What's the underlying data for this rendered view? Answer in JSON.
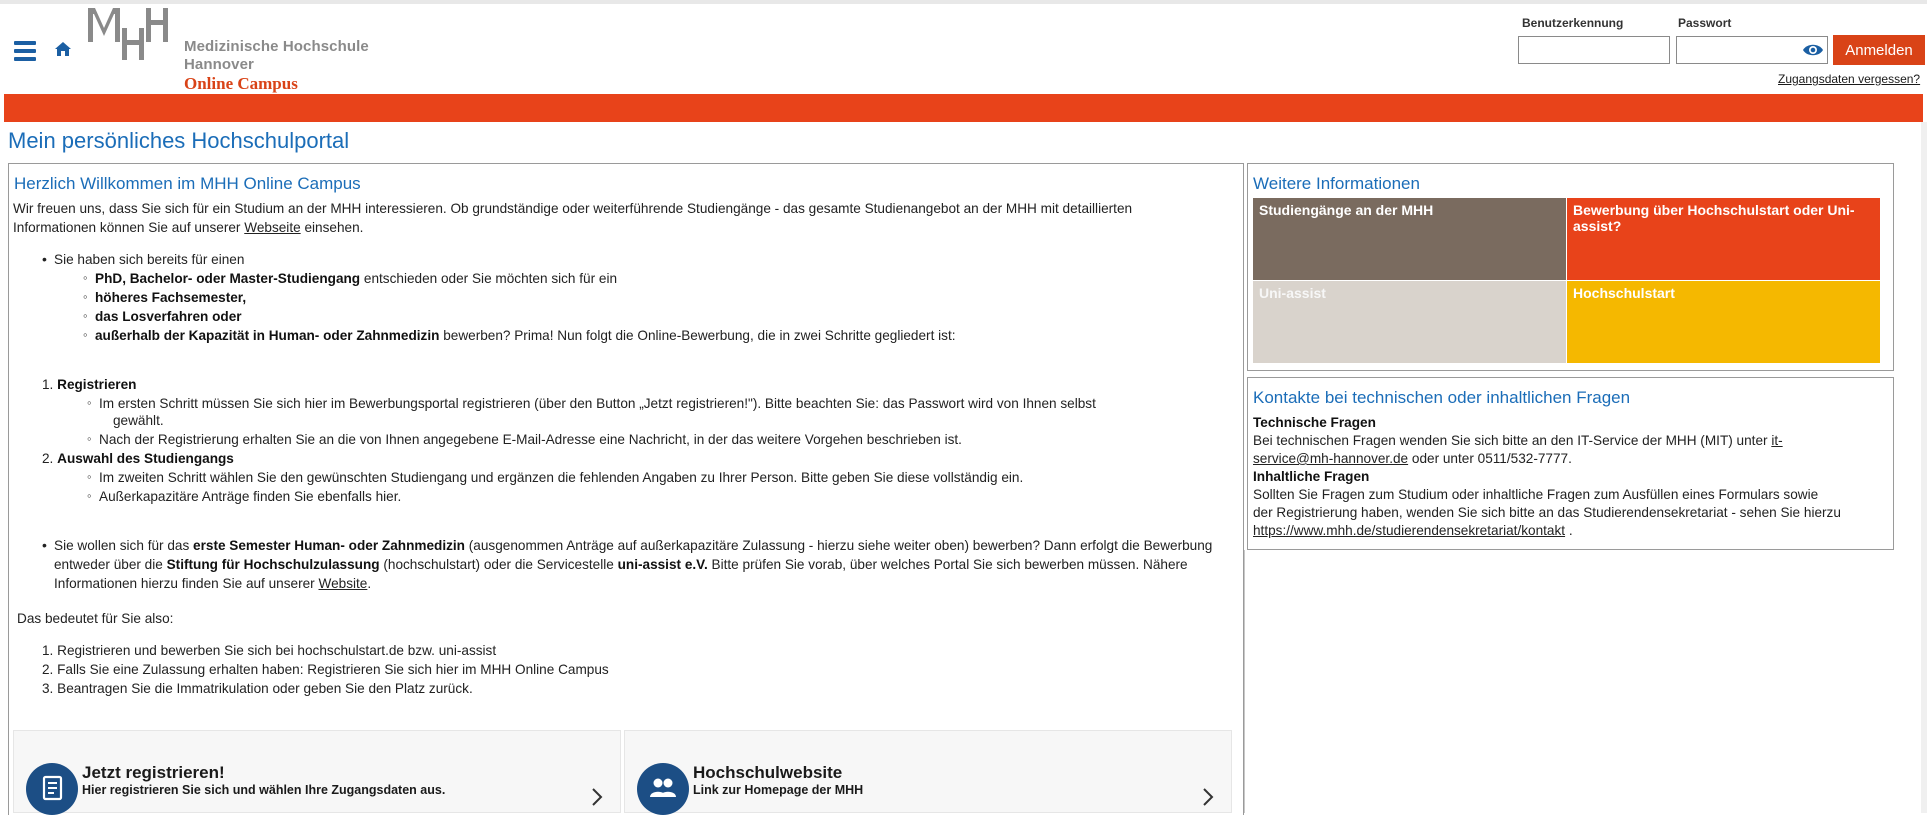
{
  "header": {
    "logo_mark": "MHH",
    "logo_line1": "Medizinische Hochschule",
    "logo_line2": "Hannover",
    "logo_campus": "Online Campus",
    "username_label": "Benutzerkennung",
    "password_label": "Passwort",
    "username_value": "",
    "password_value": "",
    "login_button": "Anmelden",
    "forgot_link": "Zugangsdaten vergessen?"
  },
  "colors": {
    "accent_orange": "#e8431a",
    "title_blue": "#1b6db8",
    "nav_blue": "#1b5fa3",
    "card_icon": "#1c4e85",
    "tile_brown": "#7a6b5f",
    "tile_red": "#e8431a",
    "tile_beige": "#d9d3cc",
    "tile_yellow": "#f5b800"
  },
  "page_title": "Mein persönliches Hochschulportal",
  "welcome": {
    "title": "Herzlich Willkommen im MHH Online Campus",
    "intro_1": "Wir freuen uns, dass Sie sich für ein Studium an der MHH interessieren. Ob grundständige oder weiterführende Studiengänge - das gesamte Studienangebot an der MHH mit detaillierten",
    "intro_2": "Informationen können Sie auf unserer",
    "intro_link": "Webseite",
    "intro_3": "einsehen.",
    "bullet_1": "Sie haben sich bereits für einen",
    "sub_1_bold": "PhD, Bachelor- oder Master-Studiengang",
    "sub_1_rest": "entschieden oder Sie möchten sich für ein",
    "sub_2_bold": "höheres Fachsemester,",
    "sub_3_bold": "das Losverfahren oder",
    "sub_4_bold": "außerhalb der Kapazität in Human- oder Zahnmedizin",
    "sub_4_rest": "bewerben? Prima! Nun folgt die Online-Bewerbung, die in zwei Schritte gegliedert ist:",
    "step_1_num": "1.",
    "step_1_title": "Registrieren",
    "step_1_a_1": "Im ersten Schritt müssen Sie sich hier im Bewerbungsportal registrieren (über den Button „Jetzt registrieren!\"). Bitte beachten Sie: das Passwort wird von Ihnen selbst",
    "step_1_a_2": "gewählt.",
    "step_1_b": "Nach der Registrierung erhalten Sie an die von Ihnen angegebene E-Mail-Adresse eine Nachricht, in der das weitere Vorgehen beschrieben ist.",
    "step_2_num": "2.",
    "step_2_title": "Auswahl des Studiengangs",
    "step_2_a": "Im zweiten Schritt wählen Sie den gewünschten Studiengang und ergänzen die fehlenden Angaben zu Ihrer Person. Bitte geben Sie diese vollständig ein.",
    "step_2_b": "Außerkapazitäre Anträge finden Sie ebenfalls hier.",
    "bullet_2_a": "Sie wollen sich für das",
    "bullet_2_b_bold": "erste Semester Human- oder Zahnmedizin",
    "bullet_2_c": "(ausgenommen Anträge auf außerkapazitäre Zulassung - hierzu siehe weiter oben) bewerben? Dann erfolgt die",
    "bullet_2_d": "Bewerbung entweder über die",
    "bullet_2_e_bold": "Stiftung für Hochschulzulassung",
    "bullet_2_f": "(hochschulstart) oder die Servicestelle",
    "bullet_2_g_bold": "uni-assist e.V.",
    "bullet_2_h": "Bitte prüfen Sie vorab, über welches Portal Sie sich bewerben",
    "bullet_2_i": "müssen. Nähere Informationen hierzu finden Sie auf unserer",
    "bullet_2_link": "Website",
    "bullet_2_end": ".",
    "meaning": "Das bedeutet für Sie also:",
    "list": [
      {
        "num": "1.",
        "text": "Registrieren und bewerben Sie sich bei hochschulstart.de bzw. uni-assist"
      },
      {
        "num": "2.",
        "text": "Falls Sie eine Zulassung erhalten haben: Registrieren Sie sich hier im MHH Online Campus"
      },
      {
        "num": "3.",
        "text": "Beantragen Sie die Immatrikulation oder geben Sie den Platz zurück."
      }
    ]
  },
  "cards": [
    {
      "title": "Jetzt registrieren!",
      "subtitle": "Hier registrieren Sie sich und wählen Ihre Zugangsdaten aus.",
      "icon": "form-icon"
    },
    {
      "title": "Hochschulwebsite",
      "subtitle": "Link zur Homepage der MHH",
      "icon": "people-icon"
    }
  ],
  "info": {
    "title": "Weitere Informationen",
    "tiles": [
      {
        "label": "Studiengänge an der MHH"
      },
      {
        "label": "Bewerbung über Hochschulstart oder Uni-assist?"
      },
      {
        "label": "Uni-assist"
      },
      {
        "label": "Hochschulstart"
      }
    ]
  },
  "contact": {
    "title": "Kontakte bei technischen oder inhaltlichen Fragen",
    "tech_heading": "Technische Fragen",
    "tech_1": "Bei technischen Fragen wenden Sie sich bitte an den IT-Service der MHH (MIT) unter",
    "tech_link_a": "it-",
    "tech_link_b": "service@mh-hannover.de",
    "tech_2": "oder unter 0511/532-7777.",
    "content_heading": "Inhaltliche Fragen",
    "content_1": "Sollten Sie Fragen zum Studium oder inhaltliche Fragen zum Ausfüllen eines Formulars sowie",
    "content_2": "der Registrierung haben, wenden Sie sich bitte an das Studierendensekretariat - sehen Sie hierzu",
    "content_link": "https://www.mhh.de/studierendensekretariat/kontakt",
    "content_end": "."
  }
}
